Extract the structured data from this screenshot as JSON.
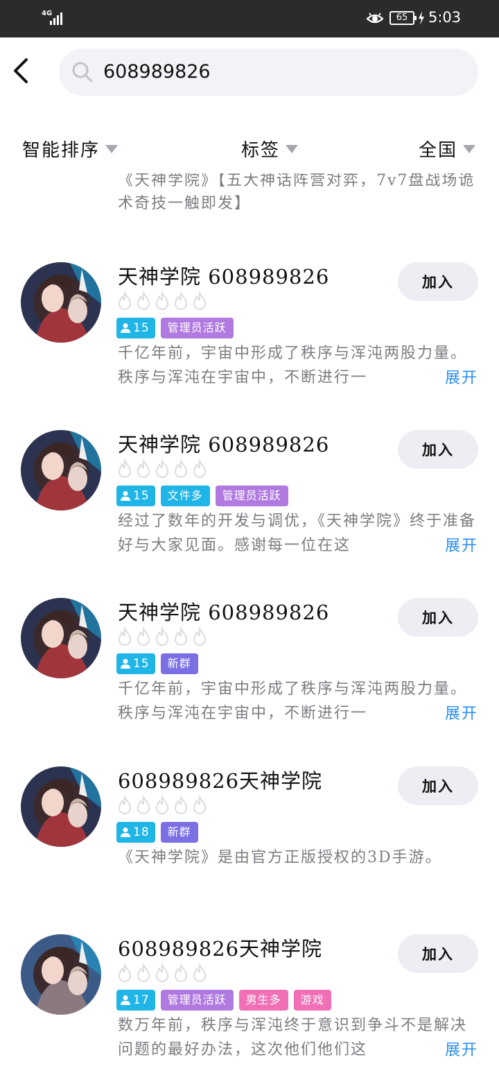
{
  "status_bar": {
    "network": "4G",
    "battery": "65",
    "time": "5:03"
  },
  "search": {
    "query": "608989826"
  },
  "filters": [
    {
      "label": "智能排序"
    },
    {
      "label": "标签"
    },
    {
      "label": "全国"
    }
  ],
  "partial_desc": "《天神学院》【五大神话阵营对弈，7v7盘战场诡术奇技一触即发】",
  "expand_label": "展开",
  "join_label": "加入",
  "groups": [
    {
      "name": "天神学院 608989826",
      "members": "15",
      "tags": [
        "管理员活跃"
      ],
      "desc": "千亿年前，宇宙中形成了秩序与浑沌两股力量。秩序与浑沌在宇宙中，不断进行一",
      "expandable": true
    },
    {
      "name": "天神学院 608989826",
      "members": "15",
      "tags": [
        "文件多",
        "管理员活跃"
      ],
      "desc": "经过了数年的开发与调优，《天神学院》终于准备好与大家见面。感谢每一位在这",
      "expandable": true
    },
    {
      "name": "天神学院 608989826",
      "members": "15",
      "tags": [
        "新群"
      ],
      "desc": "千亿年前，宇宙中形成了秩序与浑沌两股力量。秩序与浑沌在宇宙中，不断进行一",
      "expandable": true
    },
    {
      "name": "608989826天神学院",
      "members": "18",
      "tags": [
        "新群"
      ],
      "desc": "《天神学院》是由官方正版授权的3D手游。",
      "expandable": false
    },
    {
      "name": "608989826天神学院",
      "members": "17",
      "tags": [
        "管理员活跃",
        "男生多",
        "游戏"
      ],
      "desc": "数万年前，秩序与浑沌终于意识到争斗不是解决问题的最好办法，这次他们他们这",
      "expandable": true
    }
  ]
}
